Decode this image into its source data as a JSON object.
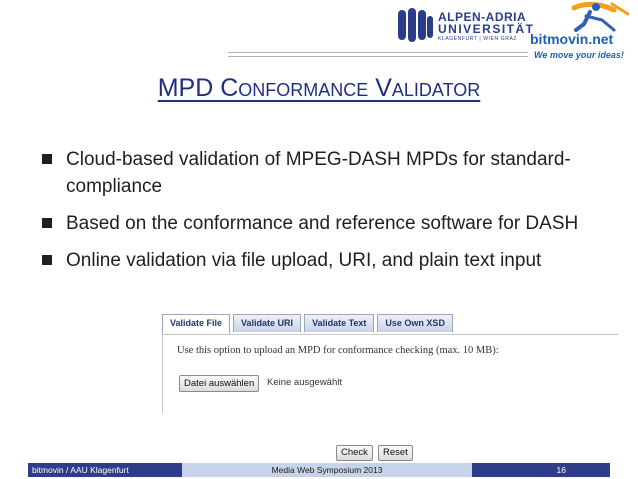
{
  "header": {
    "university_logo": {
      "line1": "ALPEN-ADRIA",
      "line2": "UNIVERSITÄT",
      "line3": "KLAGENFURT | WIEN GRAZ"
    },
    "company_logo": {
      "name": "bitmovin.net",
      "slogan": "We move your ideas!"
    }
  },
  "slide": {
    "title": "MPD Conformance Validator",
    "bullets": [
      "Cloud-based validation of MPEG-DASH MPDs for standard-compliance",
      "Based on the conformance and reference software for DASH",
      "Online validation via file upload, URI, and plain text input"
    ]
  },
  "validator": {
    "tabs": [
      "Validate File",
      "Validate URI",
      "Validate Text",
      "Use Own XSD"
    ],
    "active_tab": "Validate File",
    "instruction": "Use this option to upload an MPD for conformance checking (max. 10 MB):",
    "file_button": "Datei auswählen",
    "file_status": "Keine ausgewählt",
    "check_button": "Check",
    "reset_button": "Reset"
  },
  "footer": {
    "left": "bitmovin / AAU Klagenfurt",
    "center": "Media Web Symposium 2013",
    "page_number": "16"
  },
  "colors": {
    "title": "#1f2f80",
    "footer_dark": "#2f3d88",
    "footer_light": "#c7d3ea",
    "brand_blue": "#1f5fb0"
  }
}
